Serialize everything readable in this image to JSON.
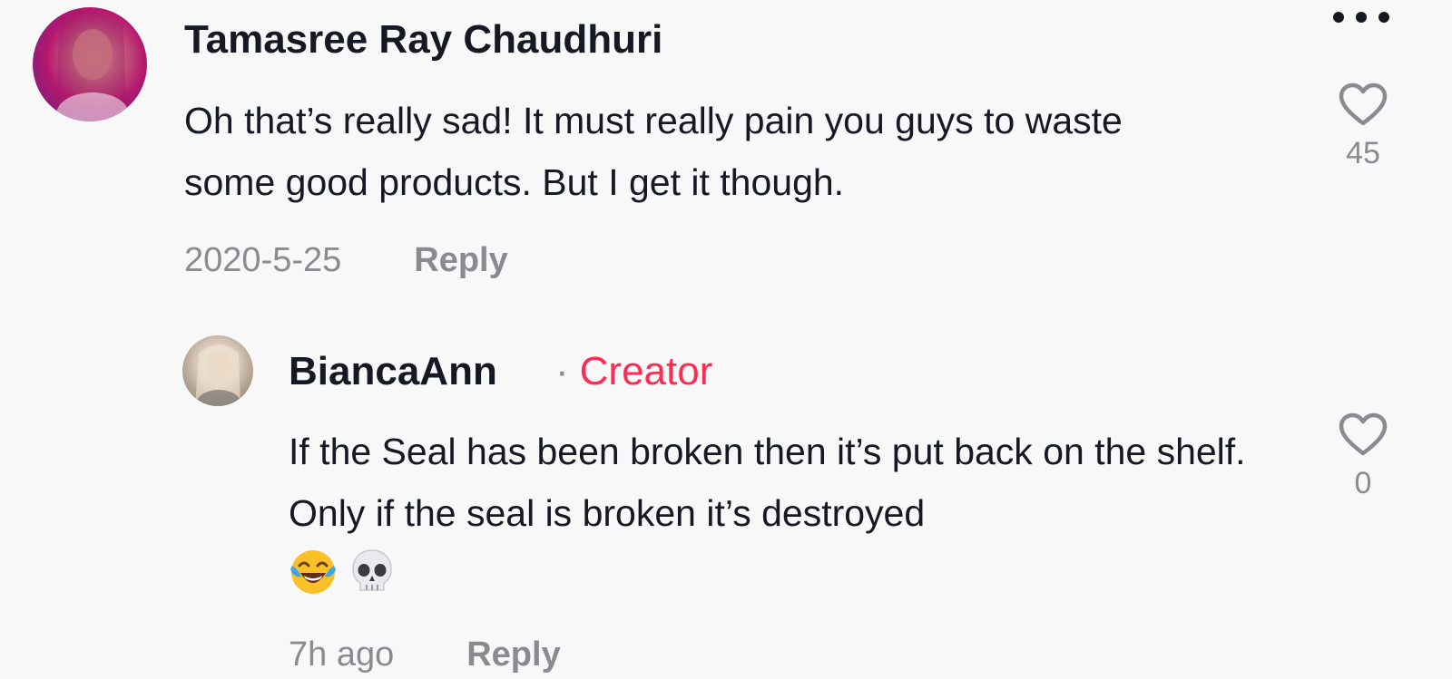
{
  "comments": [
    {
      "username": "Tamasree Ray Chaudhuri",
      "text": "Oh that’s really sad! It must really pain you guys to waste some good products. But I get it though.",
      "timestamp": "2020-5-25",
      "reply_label": "Reply",
      "like_count": "45",
      "avatar_icon": "profile-photo"
    }
  ],
  "replies": [
    {
      "username": "BiancaAnn",
      "separator": "·",
      "badge": "Creator",
      "text": "If the Seal has been broken then it’s put back on the shelf. Only if the seal is broken it’s destroyed",
      "emojis": [
        "face-with-tears-of-joy",
        "skull"
      ],
      "timestamp": "7h ago",
      "reply_label": "Reply",
      "like_count": "0",
      "avatar_icon": "profile-photo"
    }
  ],
  "icons": {
    "more": "more-horizontal-icon",
    "like": "heart-outline-icon"
  },
  "colors": {
    "background": "#f8f8f8",
    "primary_text": "#161823",
    "secondary_text": "#8a8b91",
    "creator_badge": "#fe2c55"
  }
}
